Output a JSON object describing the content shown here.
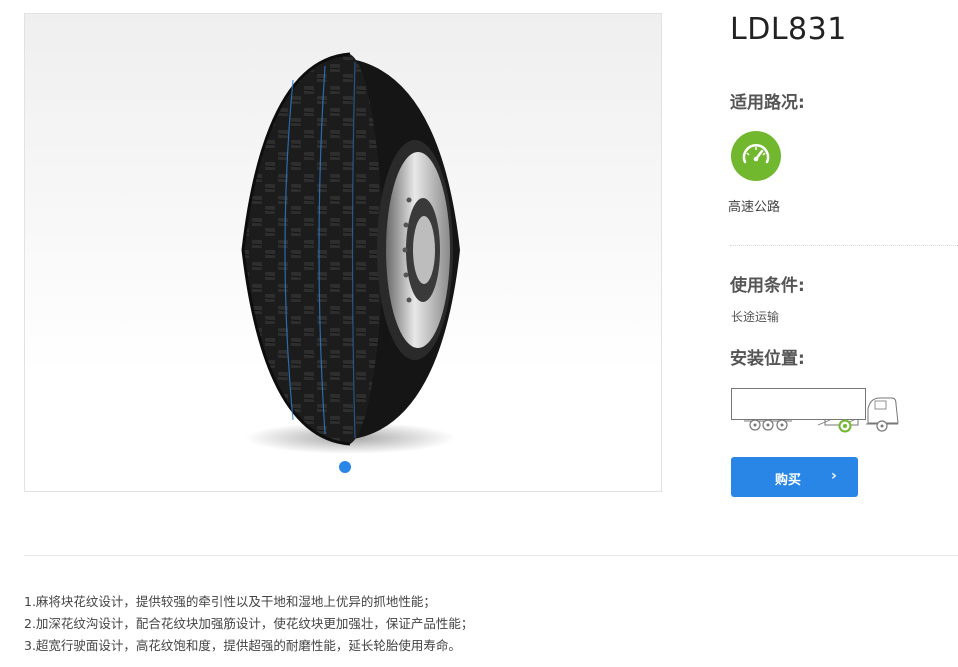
{
  "product": {
    "title": "LDL831"
  },
  "gallery": {
    "image_alt": "tire-image",
    "active_index": 0,
    "slide_count": 1
  },
  "road": {
    "heading": "适用路况:",
    "items": [
      {
        "icon": "speedometer-icon",
        "label": "高速公路"
      }
    ]
  },
  "conditions": {
    "heading": "使用条件:",
    "value": "长途运输"
  },
  "position": {
    "heading": "安装位置:",
    "icon": "truck-axle-diagram"
  },
  "buy_button": {
    "label": "购买",
    "icon": "chevron-right-icon",
    "arrow": "›"
  },
  "features": [
    "1.麻将块花纹设计，提供较强的牵引性以及干地和湿地上优异的抓地性能；",
    "2.加深花纹沟设计，配合花纹块加强筋设计，使花纹块更加强壮，保证产品性能；",
    "3.超宽行驶面设计，高花纹饱和度，提供超强的耐磨性能，延长轮胎使用寿命。"
  ],
  "colors": {
    "accent": "#2a86e6",
    "road_icon_bg": "#72b82e",
    "text": "#333333"
  }
}
